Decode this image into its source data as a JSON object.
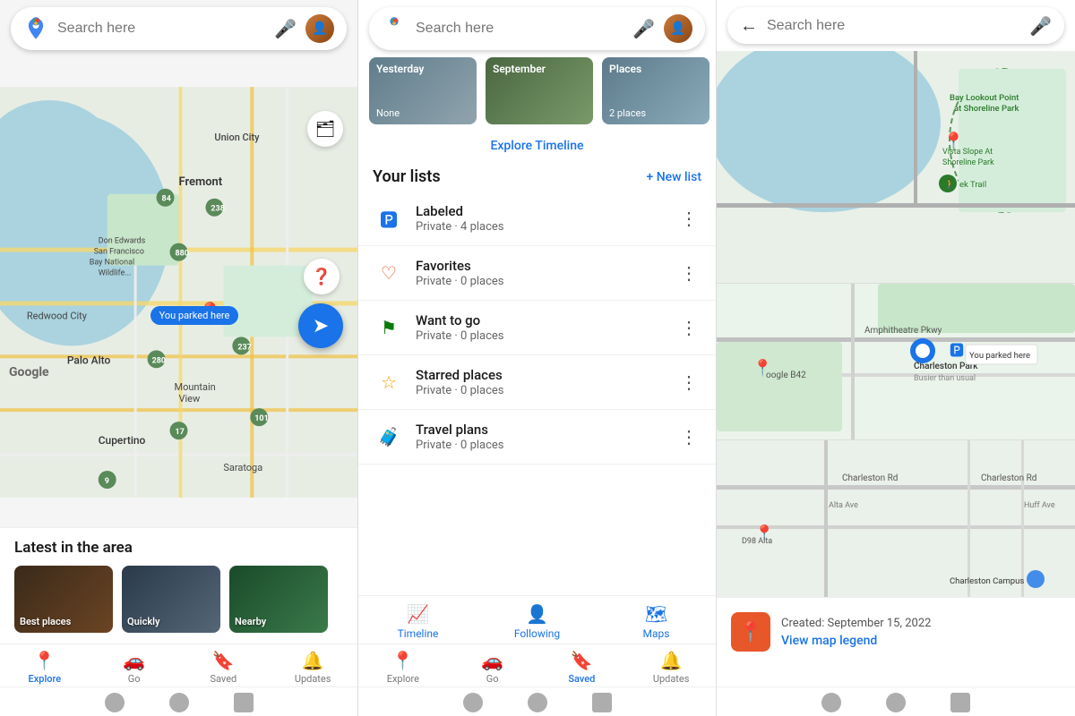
{
  "panels": {
    "left": {
      "search_placeholder": "Search here",
      "map_label": "You parked here",
      "google_watermark": "Google",
      "latest_title": "Latest in the area",
      "cards": [
        {
          "label": "Best places",
          "bg_class": "card-bg-1"
        },
        {
          "label": "Quickly",
          "bg_class": "card-bg-2"
        },
        {
          "label": "Nearby",
          "bg_class": "card-bg-3"
        }
      ],
      "nav_items": [
        {
          "label": "Explore",
          "icon": "📍",
          "active": true
        },
        {
          "label": "Go",
          "icon": "🚗",
          "active": false
        },
        {
          "label": "Saved",
          "icon": "🔖",
          "active": false
        },
        {
          "label": "Updates",
          "icon": "🔔",
          "active": false
        }
      ]
    },
    "middle": {
      "search_placeholder": "Search here",
      "timeline_cards": [
        {
          "top_label": "Yesterday",
          "bottom_label": "None",
          "bg": "tc-bg-1"
        },
        {
          "top_label": "September",
          "bottom_label": "",
          "bg": "tc-bg-2"
        },
        {
          "top_label": "Places",
          "bottom_label": "2 places",
          "bg": "tc-bg-3"
        }
      ],
      "explore_timeline": "Explore Timeline",
      "lists_title": "Your lists",
      "new_list_label": "+ New list",
      "lists": [
        {
          "name": "Labeled",
          "sub": "Private · 4 places",
          "icon": "🅿",
          "color": "#1a73e8"
        },
        {
          "name": "Favorites",
          "sub": "Private · 0 places",
          "icon": "♡",
          "color": "#e8572a"
        },
        {
          "name": "Want to go",
          "sub": "Private · 0 places",
          "icon": "⚑",
          "color": "#0a7a0a"
        },
        {
          "name": "Starred places",
          "sub": "Private · 0 places",
          "icon": "☆",
          "color": "#f4a300"
        },
        {
          "name": "Travel plans",
          "sub": "Private · 0 places",
          "icon": "🧳",
          "color": "#1a73e8"
        }
      ],
      "secondary_nav": [
        {
          "label": "Timeline",
          "icon": "📈"
        },
        {
          "label": "Following",
          "icon": "👤"
        },
        {
          "label": "Maps",
          "icon": "🗺"
        }
      ],
      "nav_items": [
        {
          "label": "Explore",
          "icon": "📍",
          "active": false
        },
        {
          "label": "Go",
          "icon": "🚗",
          "active": false
        },
        {
          "label": "Saved",
          "icon": "🔖",
          "active": true
        },
        {
          "label": "Updates",
          "icon": "🔔",
          "active": false
        }
      ]
    },
    "right": {
      "search_placeholder": "Search here",
      "map_labels": {
        "bay_lookout": "Bay Lookout Point at Shoreline Park",
        "vista_slope": "Vista Slope At Shoreline Park",
        "ek_trail": "ek Trail",
        "amphitheatre": "Amphitheatre Pkwy",
        "charleston_park": "Charleston Park",
        "busier_than_usual": "Busier than usual",
        "google_b42": "oogle B42",
        "charleston_rd": "Charleston Rd",
        "charleston_campus": "Charleston Campus",
        "alta_ave": "Alta Ave",
        "huff_ave": "Huff Ave",
        "d98_alta": "D98 Alta"
      },
      "location_card": {
        "date_text": "Created: September 15, 2022",
        "view_legend": "View map legend"
      }
    }
  }
}
